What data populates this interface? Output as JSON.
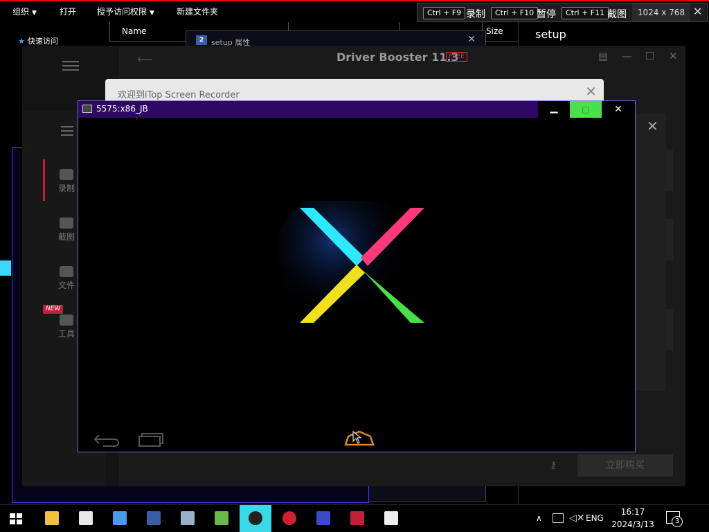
{
  "explorer": {
    "toolbar": {
      "organize": "组织",
      "open": "打开",
      "grant_access": "授予访问权限",
      "new_folder": "新建文件夹"
    },
    "nav": {
      "quick_access": "快速访问"
    },
    "columns": {
      "name": "Name",
      "size": "Size"
    },
    "preview_title": "setup"
  },
  "shortcut_bar": {
    "record_key": "Ctrl + F9",
    "record_label": "录制",
    "pause_key": "Ctrl + F10",
    "pause_label": "暂停",
    "screenshot_key": "Ctrl + F11",
    "screenshot_label": "截图",
    "resolution": "1024 x 768",
    "close_glyph": "✕"
  },
  "setup_dialog": {
    "title": "setup 属性",
    "icon_text": "2"
  },
  "driver_booster": {
    "title": "Driver Booster 11.3",
    "badge": "FREE",
    "buy_button": "立即购买"
  },
  "itop": {
    "welcome_title": "欢迎到iTop Screen Recorder",
    "nav": {
      "record": "录制",
      "screenshot": "截图",
      "files": "文件",
      "tools": "工具"
    },
    "new_badge": "NEW"
  },
  "emulator": {
    "title": "5575:x86_JB",
    "min_glyph": "▁",
    "max_glyph": "□",
    "close_glyph": "✕"
  },
  "taskbar": {
    "lang": "ENG",
    "time": "16:17",
    "date": "2024/3/13",
    "notifications": "3",
    "icons": [
      "file-explorer",
      "photos",
      "file-manager",
      "winrar-sfx",
      "control-panel",
      "android-studio",
      "cpu-z",
      "settings-red",
      "driver-tool",
      "itop-recorder",
      "yg-pulse"
    ]
  },
  "colors": {
    "emu_titlebar": "#2e0863",
    "emu_max": "#4ce04c",
    "accent_red": "#c0203a",
    "taskbar_active": "#3ad8e8"
  }
}
